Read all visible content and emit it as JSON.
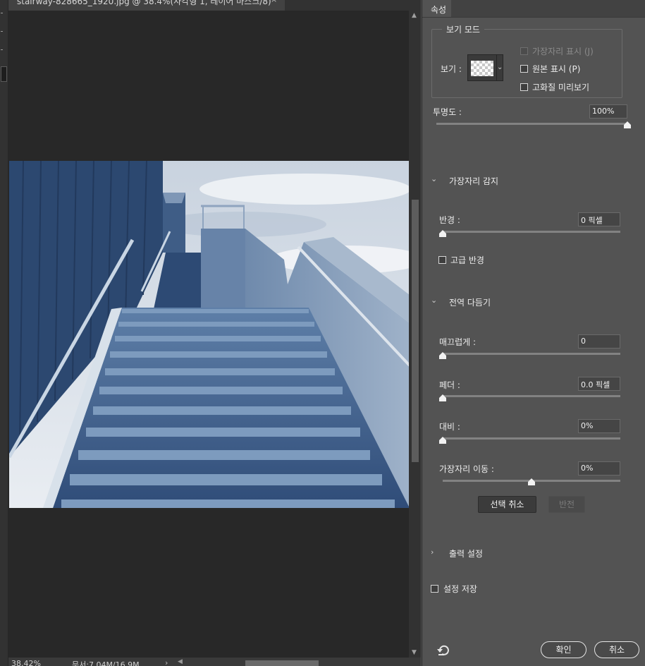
{
  "document": {
    "tab_title": "stairway-828665_1920.jpg @ 38.4%(사각형 1, 레이어 마스크/8)",
    "tab_close": "×",
    "zoom": "38.42%",
    "info": "문서:7.04M/16.9M",
    "info_arrow": "›"
  },
  "panel": {
    "tab_label": "속성",
    "view_mode": {
      "group_title": "보기 모드",
      "view_label": "보기 :",
      "show_edge": "가장자리 표시 (J)",
      "show_original": "원본 표시 (P)",
      "hq_preview": "고화질 미리보기"
    },
    "opacity": {
      "label": "투명도 :",
      "value": "100%",
      "level": 1.0
    },
    "edge_detection": {
      "title": "가장자리 감지",
      "radius_label": "반경 :",
      "radius_value": "0 픽셀",
      "radius_level": 0.0,
      "smart_radius": "고급 반경"
    },
    "global_refine": {
      "title": "전역 다듬기",
      "smooth_label": "매끄럽게 :",
      "smooth_value": "0",
      "smooth_level": 0.0,
      "feather_label": "페더 :",
      "feather_value": "0.0 픽셀",
      "feather_level": 0.0,
      "contrast_label": "대비 :",
      "contrast_value": "0%",
      "contrast_level": 0.0,
      "shift_label": "가장자리 이동 :",
      "shift_value": "0%",
      "shift_level": 0.5,
      "deselect": "선택 취소",
      "invert": "반전"
    },
    "output": {
      "title": "출력 설정"
    },
    "remember": "설정 저장",
    "ok": "확인",
    "cancel": "취소"
  },
  "icons": {
    "tab_close": "close-icon",
    "scroll_up": "triangle-up-icon",
    "scroll_down": "triangle-down-icon",
    "collapse": "chevron-down-icon",
    "expand": "chevron-right-icon",
    "reset": "reset-icon",
    "transparency": "checkerboard-swatch"
  },
  "colors": {
    "panel_bg": "#535353",
    "canvas_bg": "#282828",
    "field_bg": "#454545",
    "photo_tint": "#3d5f8c"
  }
}
